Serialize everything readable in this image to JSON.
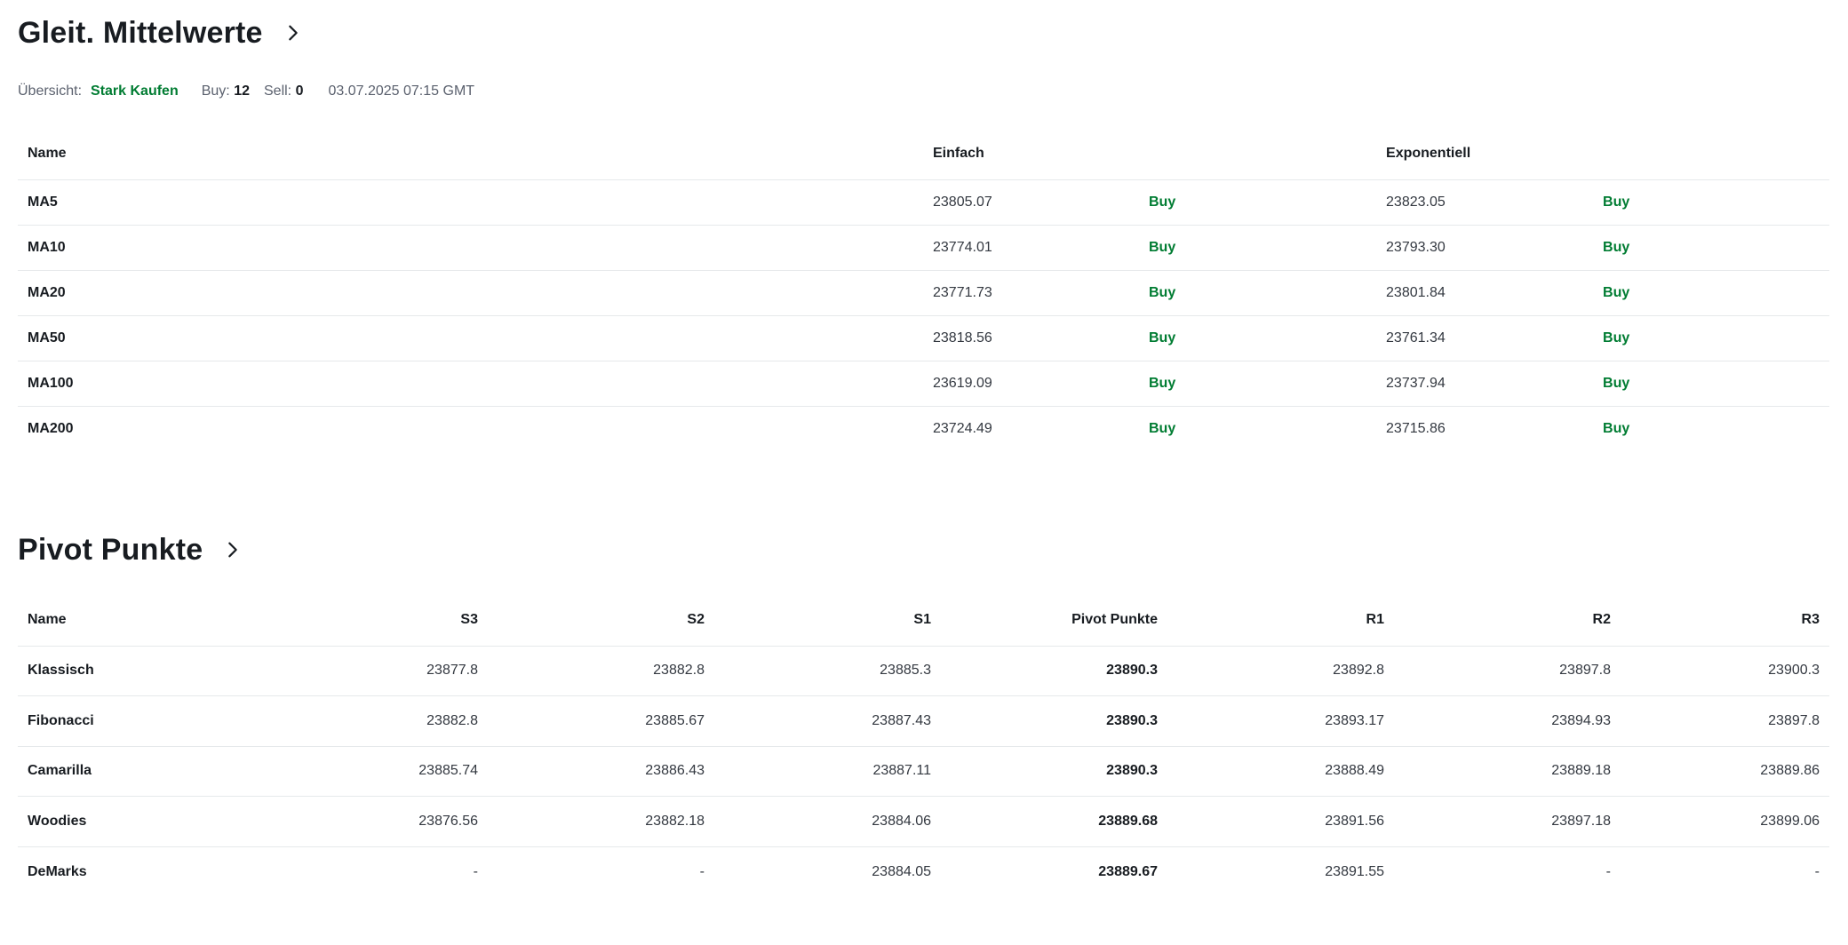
{
  "moving_averages": {
    "title": "Gleit. Mittelwerte",
    "summary": {
      "label": "Übersicht:",
      "verdict": "Stark Kaufen",
      "buy_label": "Buy:",
      "buy_count": "12",
      "sell_label": "Sell:",
      "sell_count": "0",
      "timestamp": "03.07.2025 07:15 GMT"
    },
    "headers": {
      "name": "Name",
      "simple": "Einfach",
      "exponential": "Exponentiell"
    },
    "rows": [
      {
        "name": "MA5",
        "simple": "23805.07",
        "simple_signal": "Buy",
        "exp": "23823.05",
        "exp_signal": "Buy"
      },
      {
        "name": "MA10",
        "simple": "23774.01",
        "simple_signal": "Buy",
        "exp": "23793.30",
        "exp_signal": "Buy"
      },
      {
        "name": "MA20",
        "simple": "23771.73",
        "simple_signal": "Buy",
        "exp": "23801.84",
        "exp_signal": "Buy"
      },
      {
        "name": "MA50",
        "simple": "23818.56",
        "simple_signal": "Buy",
        "exp": "23761.34",
        "exp_signal": "Buy"
      },
      {
        "name": "MA100",
        "simple": "23619.09",
        "simple_signal": "Buy",
        "exp": "23737.94",
        "exp_signal": "Buy"
      },
      {
        "name": "MA200",
        "simple": "23724.49",
        "simple_signal": "Buy",
        "exp": "23715.86",
        "exp_signal": "Buy"
      }
    ]
  },
  "pivot_points": {
    "title": "Pivot Punkte",
    "headers": [
      "Name",
      "S3",
      "S2",
      "S1",
      "Pivot Punkte",
      "R1",
      "R2",
      "R3"
    ],
    "rows": [
      [
        "Klassisch",
        "23877.8",
        "23882.8",
        "23885.3",
        "23890.3",
        "23892.8",
        "23897.8",
        "23900.3"
      ],
      [
        "Fibonacci",
        "23882.8",
        "23885.67",
        "23887.43",
        "23890.3",
        "23893.17",
        "23894.93",
        "23897.8"
      ],
      [
        "Camarilla",
        "23885.74",
        "23886.43",
        "23887.11",
        "23890.3",
        "23888.49",
        "23889.18",
        "23889.86"
      ],
      [
        "Woodies",
        "23876.56",
        "23882.18",
        "23884.06",
        "23889.68",
        "23891.56",
        "23897.18",
        "23899.06"
      ],
      [
        "DeMarks",
        "-",
        "-",
        "23884.05",
        "23889.67",
        "23891.55",
        "-",
        "-"
      ]
    ]
  },
  "colors": {
    "buy": "#007c32",
    "text": "#181c21",
    "muted": "#5b616e",
    "divider": "#e6e9eb"
  },
  "icons": {
    "section_link": "chevron-right-icon"
  }
}
